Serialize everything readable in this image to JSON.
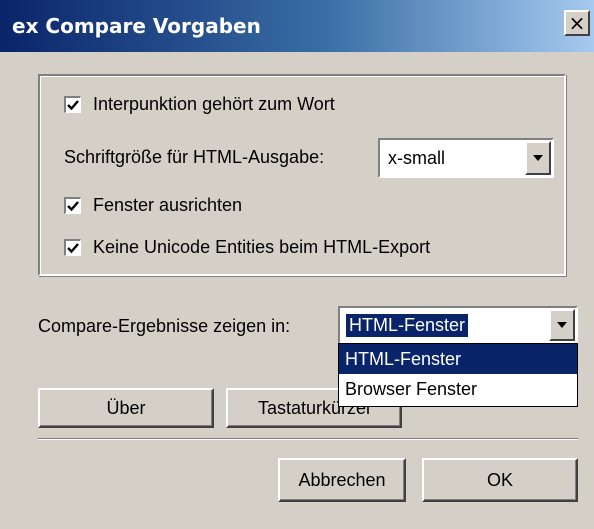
{
  "window": {
    "title": "ex Compare Vorgaben",
    "close_glyph": "×"
  },
  "options": {
    "punctuation": {
      "label": "Interpunktion gehört zum Wort",
      "checked": true
    },
    "font_size": {
      "label": "Schriftgröße für HTML-Ausgabe:",
      "value": "x-small"
    },
    "align_window": {
      "label": "Fenster ausrichten",
      "checked": true
    },
    "no_unicode_entities": {
      "label": "Keine Unicode Entities beim HTML-Export",
      "checked": true
    }
  },
  "results": {
    "label": "Compare-Ergebnisse zeigen in:",
    "value": "HTML-Fenster",
    "dropdown_open": true,
    "options": [
      "HTML-Fenster",
      "Browser Fenster"
    ],
    "highlighted_index": 0
  },
  "buttons": {
    "about": "Über",
    "shortcuts_visible": "Tastaturkürzel",
    "cancel": "Abbrechen",
    "ok": "OK"
  },
  "icons": {
    "close": "close-icon",
    "dropdown_arrow": "chevron-down-icon",
    "checkmark": "checkmark-icon"
  },
  "colors": {
    "titlebar_start": "#0a246a",
    "titlebar_end": "#a6caf0",
    "dialog_face": "#d4d0c8",
    "selection": "#0a246a"
  }
}
